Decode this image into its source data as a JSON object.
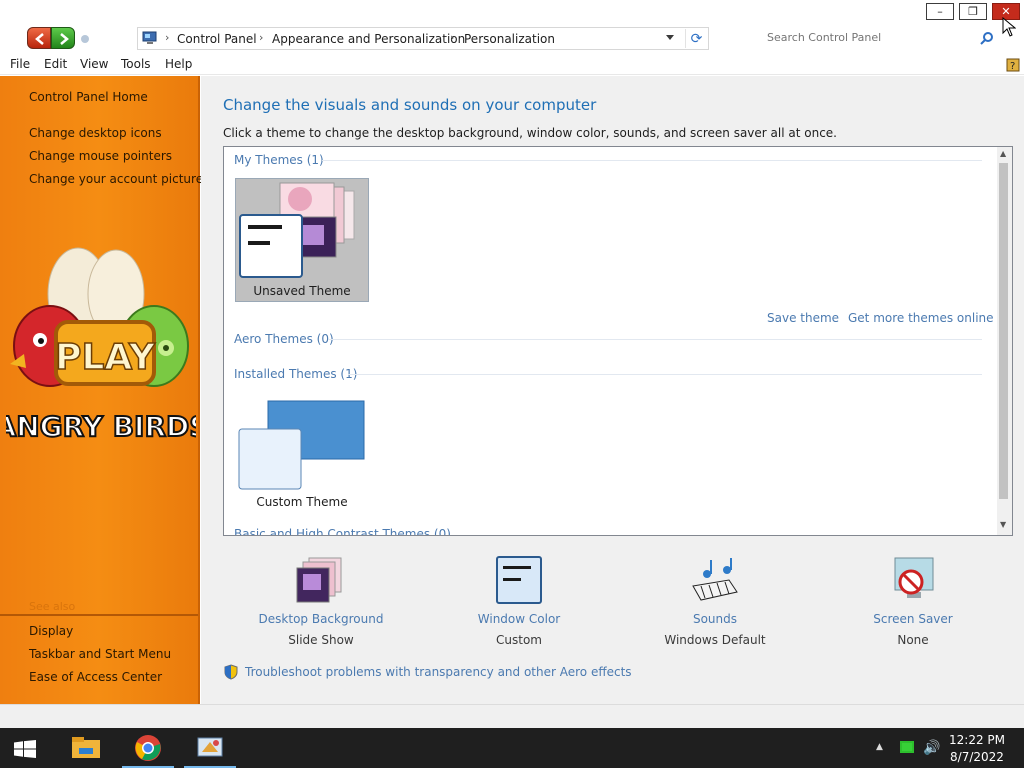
{
  "window": {
    "minimize_glyph": "–",
    "maximize_glyph": "❐",
    "close_glyph": "✕"
  },
  "address": {
    "crumbs": [
      "Control Panel",
      "Appearance and Personalization",
      "Personalization"
    ],
    "search_placeholder": "Search Control Panel"
  },
  "menu": [
    "File",
    "Edit",
    "View",
    "Tools",
    "Help"
  ],
  "sidebar": {
    "home": "Control Panel Home",
    "links": [
      "Change desktop icons",
      "Change mouse pointers",
      "Change your account picture"
    ],
    "see_also": "See also",
    "see_also_links": [
      "Display",
      "Taskbar and Start Menu",
      "Ease of Access Center"
    ],
    "artwork_text": {
      "play": "PLAY",
      "brand": "ANGRY BIRDS"
    }
  },
  "main": {
    "title": "Change the visuals and sounds on your computer",
    "description": "Click a theme to change the desktop background, window color, sounds, and screen saver all at once.",
    "groups": {
      "my_themes": "My Themes (1)",
      "aero_themes": "Aero Themes (0)",
      "installed_themes": "Installed Themes (1)",
      "basic_themes": "Basic and High Contrast Themes (0)"
    },
    "themes": {
      "unsaved": "Unsaved Theme",
      "installed": "Custom Theme"
    },
    "links": {
      "save_theme": "Save theme",
      "get_more": "Get more themes online"
    },
    "bottom_items": [
      {
        "label": "Desktop Background",
        "value": "Slide Show"
      },
      {
        "label": "Window Color",
        "value": "Custom"
      },
      {
        "label": "Sounds",
        "value": "Windows Default"
      },
      {
        "label": "Screen Saver",
        "value": "None"
      }
    ],
    "troubleshoot": "Troubleshoot problems with transparency and other Aero effects"
  },
  "taskbar": {
    "apps": [
      "file-explorer",
      "chrome",
      "personalization"
    ],
    "time": "12:22 PM",
    "date": "8/7/2022"
  },
  "colors": {
    "sidebar_orange": "#f58d13",
    "link_blue": "#4b7ab0",
    "title_blue": "#1f6fb5",
    "taskbar": "#1f1f1f"
  }
}
